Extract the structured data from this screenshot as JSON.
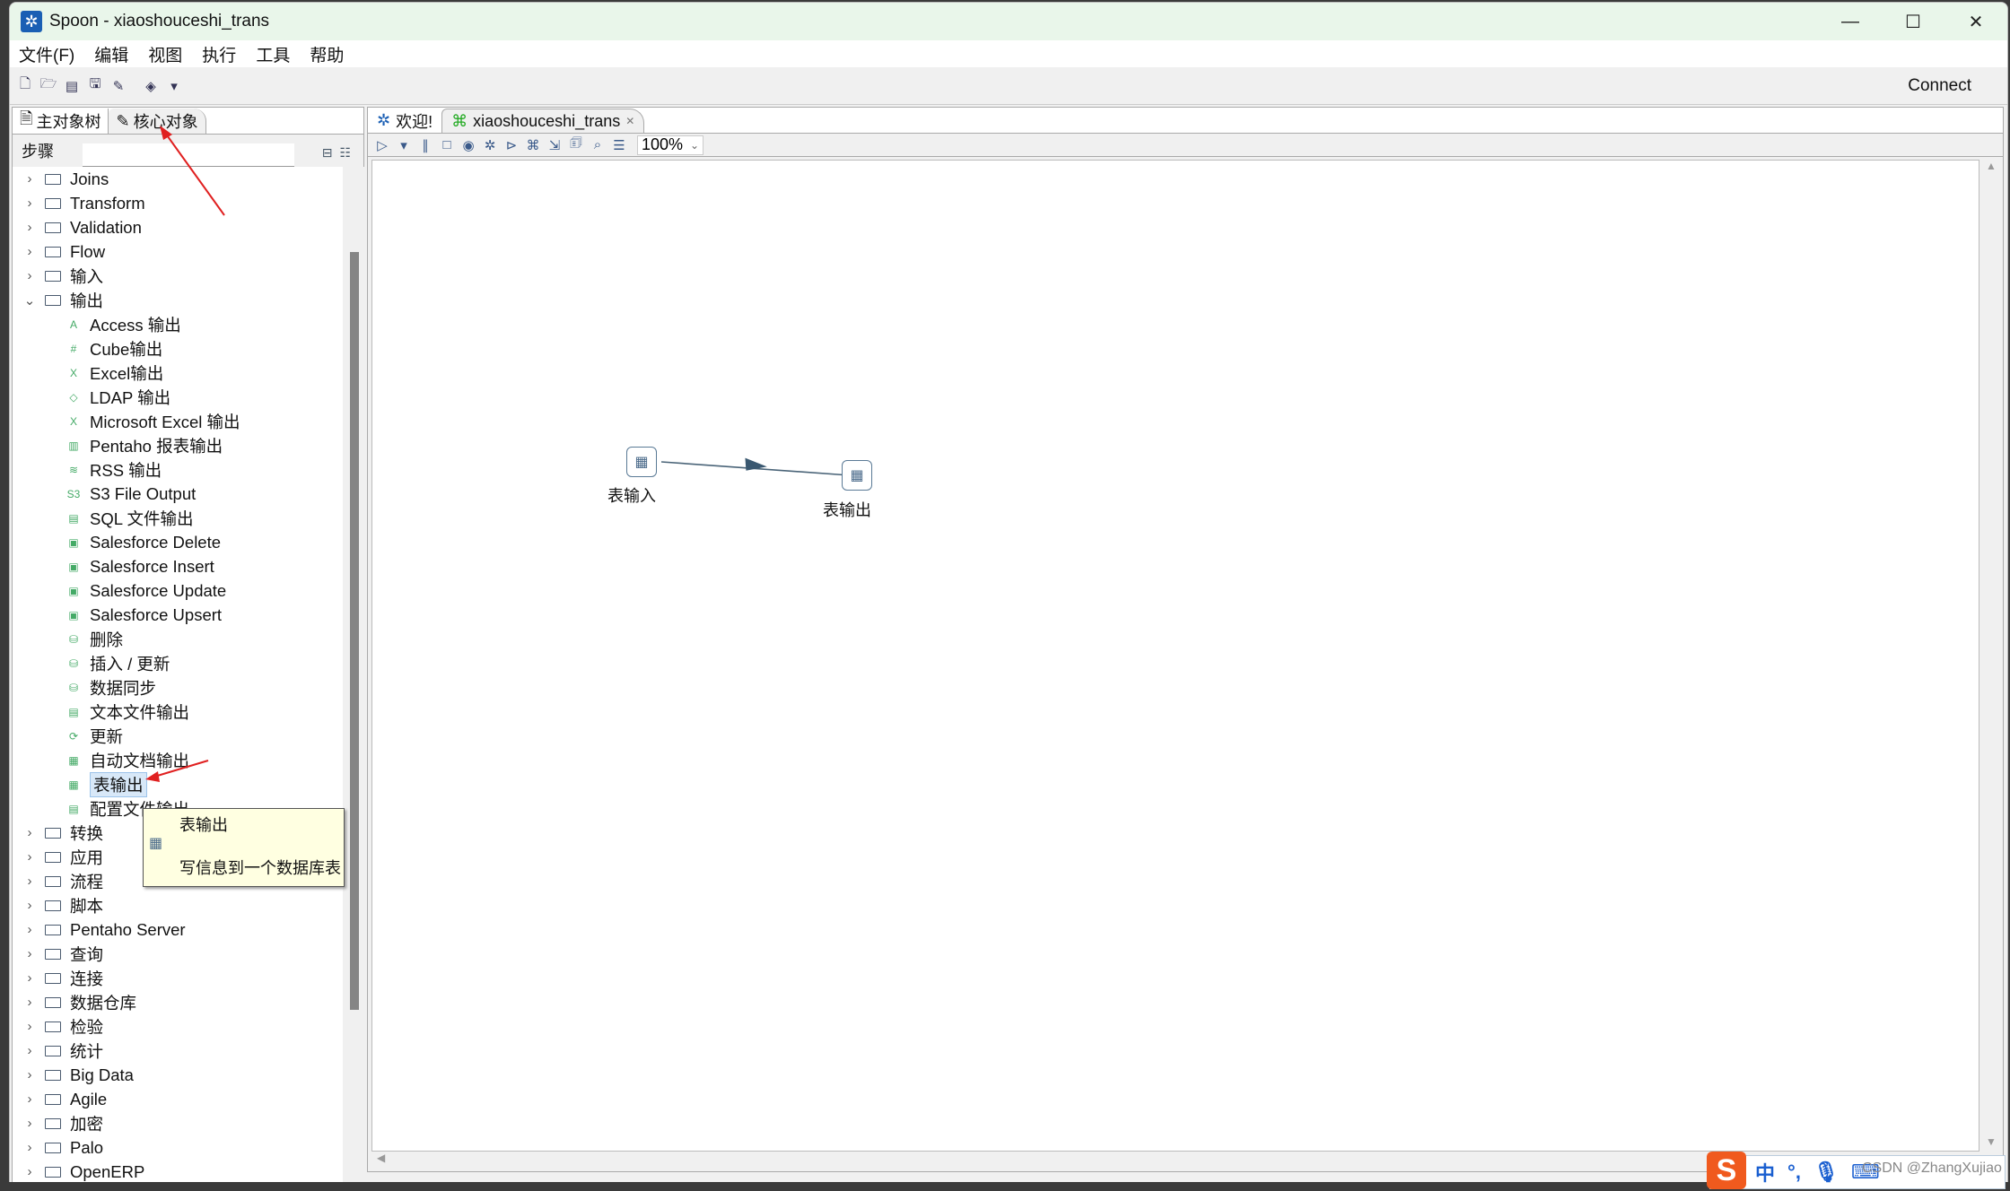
{
  "window": {
    "title": "Spoon - xiaoshouceshi_trans",
    "minimize": "—",
    "maximize": "☐",
    "close": "✕"
  },
  "menu": [
    "文件(F)",
    "编辑",
    "视图",
    "执行",
    "工具",
    "帮助"
  ],
  "toolbar": {
    "connect_label": "Connect"
  },
  "left_panel": {
    "tabs": [
      {
        "label": "主对象树",
        "icon": "tree-icon"
      },
      {
        "label": "核心对象",
        "icon": "pencil-icon"
      }
    ],
    "active_tab": "核心对象",
    "steps_label": "步骤",
    "search_value": "",
    "tree": [
      {
        "label": "Joins",
        "type": "folder",
        "expanded": false
      },
      {
        "label": "Transform",
        "type": "folder",
        "expanded": false
      },
      {
        "label": "Validation",
        "type": "folder",
        "expanded": false
      },
      {
        "label": "Flow",
        "type": "folder",
        "expanded": false
      },
      {
        "label": "输入",
        "type": "folder",
        "expanded": false
      },
      {
        "label": "输出",
        "type": "folder",
        "expanded": true
      },
      {
        "label": "Access 输出",
        "type": "leaf",
        "icon": "A"
      },
      {
        "label": "Cube输出",
        "type": "leaf",
        "icon": "#"
      },
      {
        "label": "Excel输出",
        "type": "leaf",
        "icon": "X"
      },
      {
        "label": "LDAP 输出",
        "type": "leaf",
        "icon": "◇"
      },
      {
        "label": "Microsoft Excel 输出",
        "type": "leaf",
        "icon": "X"
      },
      {
        "label": "Pentaho 报表输出",
        "type": "leaf",
        "icon": "▥"
      },
      {
        "label": "RSS 输出",
        "type": "leaf",
        "icon": "≋"
      },
      {
        "label": "S3 File Output",
        "type": "leaf",
        "icon": "S3"
      },
      {
        "label": "SQL 文件输出",
        "type": "leaf",
        "icon": "▤"
      },
      {
        "label": "Salesforce Delete",
        "type": "leaf",
        "icon": "▣"
      },
      {
        "label": "Salesforce Insert",
        "type": "leaf",
        "icon": "▣"
      },
      {
        "label": "Salesforce Update",
        "type": "leaf",
        "icon": "▣"
      },
      {
        "label": "Salesforce Upsert",
        "type": "leaf",
        "icon": "▣"
      },
      {
        "label": "删除",
        "type": "leaf",
        "icon": "⛁"
      },
      {
        "label": "插入 / 更新",
        "type": "leaf",
        "icon": "⛁"
      },
      {
        "label": "数据同步",
        "type": "leaf",
        "icon": "⛁"
      },
      {
        "label": "文本文件输出",
        "type": "leaf",
        "icon": "▤"
      },
      {
        "label": "更新",
        "type": "leaf",
        "icon": "⟳"
      },
      {
        "label": "自动文档输出",
        "type": "leaf",
        "icon": "▦"
      },
      {
        "label": "表输出",
        "type": "leaf",
        "icon": "▦",
        "selected": true
      },
      {
        "label": "配置文件输出",
        "type": "leaf",
        "icon": "▤"
      },
      {
        "label": "转换",
        "type": "folder",
        "expanded": false
      },
      {
        "label": "应用",
        "type": "folder",
        "expanded": false
      },
      {
        "label": "流程",
        "type": "folder",
        "expanded": false
      },
      {
        "label": "脚本",
        "type": "folder",
        "expanded": false
      },
      {
        "label": "Pentaho Server",
        "type": "folder",
        "expanded": false
      },
      {
        "label": "查询",
        "type": "folder",
        "expanded": false
      },
      {
        "label": "连接",
        "type": "folder",
        "expanded": false
      },
      {
        "label": "数据仓库",
        "type": "folder",
        "expanded": false
      },
      {
        "label": "检验",
        "type": "folder",
        "expanded": false
      },
      {
        "label": "统计",
        "type": "folder",
        "expanded": false
      },
      {
        "label": "Big Data",
        "type": "folder",
        "expanded": false
      },
      {
        "label": "Agile",
        "type": "folder",
        "expanded": false
      },
      {
        "label": "加密",
        "type": "folder",
        "expanded": false
      },
      {
        "label": "Palo",
        "type": "folder",
        "expanded": false
      },
      {
        "label": "OpenERP",
        "type": "folder",
        "expanded": false
      }
    ],
    "tooltip": {
      "title": "表输出",
      "description": "写信息到一个数据库表"
    }
  },
  "editor": {
    "tabs": [
      {
        "label": "欢迎!",
        "closable": false
      },
      {
        "label": "xiaoshouceshi_trans",
        "closable": true,
        "active": true
      }
    ],
    "zoom": "100%",
    "steps": [
      {
        "label": "表输入",
        "icon": "table-input-icon"
      },
      {
        "label": "表输出",
        "icon": "table-output-icon"
      }
    ],
    "hops": [
      {
        "from": "表输入",
        "to": "表输出"
      }
    ]
  },
  "ime": {
    "mode": "中",
    "punct": "°,",
    "watermark": "CSDN @ZhangXujiao"
  },
  "colors": {
    "titlebar": "#e9f6ea",
    "annotation_arrow": "#e02020",
    "selection": "#d8e8f8",
    "tooltip": "#ffffe1"
  }
}
